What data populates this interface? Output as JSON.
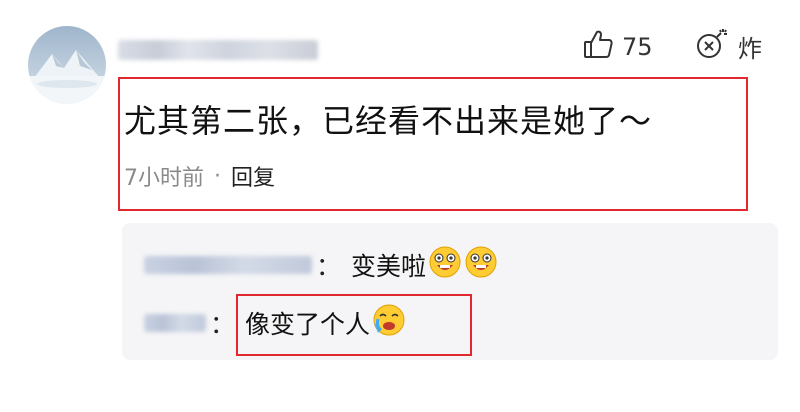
{
  "comment": {
    "text": "尤其第二张，已经看不出来是她了～",
    "time": "7小时前",
    "separator": "·",
    "reply_label": "回复",
    "likes": "75",
    "bomb_label": "炸"
  },
  "replies": [
    {
      "separator": "：",
      "text": "变美啦",
      "emojis": [
        "laughing-face-emoji",
        "laughing-face-emoji"
      ]
    },
    {
      "separator": "：",
      "text": "像变了个人",
      "emojis": [
        "crying-face-emoji"
      ]
    }
  ],
  "colors": {
    "highlight_box": "#e0282e",
    "reply_background": "#f5f5f7",
    "muted_text": "#8a8a8a"
  },
  "icons": [
    "thumbs-up-icon",
    "bomb-icon"
  ]
}
